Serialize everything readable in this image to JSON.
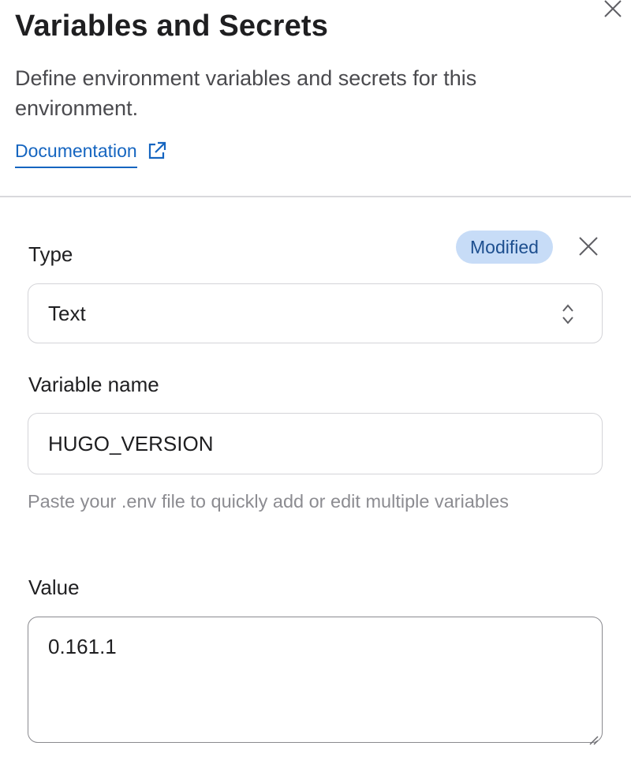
{
  "header": {
    "title": "Variables and Secrets",
    "description": "Define environment variables and secrets for this environment.",
    "doc_link_label": "Documentation",
    "close_icon": "close-icon",
    "external_icon": "external-link-icon"
  },
  "form": {
    "type_label": "Type",
    "status_badge": "Modified",
    "type_value": "Text",
    "name_label": "Variable name",
    "name_value": "HUGO_VERSION",
    "hint": "Paste your .env file to quickly add or edit multiple variables",
    "value_label": "Value",
    "value": "0.161.1"
  },
  "colors": {
    "link": "#1565c0",
    "badge_bg": "#c7dcf7",
    "badge_text": "#1d4f8f",
    "divider": "#d9d9dc"
  }
}
